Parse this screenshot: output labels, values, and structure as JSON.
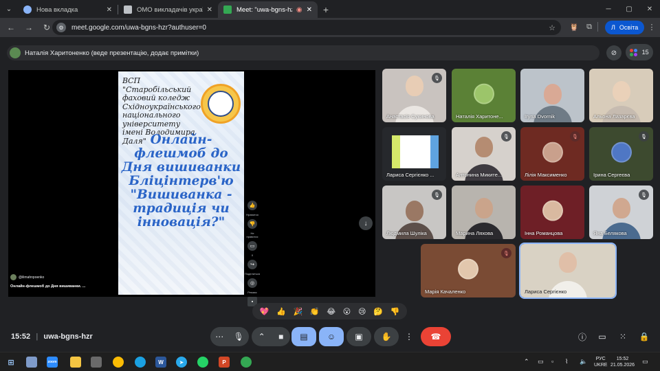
{
  "browser": {
    "tabs": [
      {
        "title": "Нова вкладка",
        "fav_color": "#8ab4f8"
      },
      {
        "title": "ОМО викладачів української л",
        "fav_color": "#bdc1c6"
      },
      {
        "title": "Meet: \"uwa-bgns-hzr\"",
        "fav_color": "#34a853"
      }
    ],
    "url": "meet.google.com/uwa-bgns-hzr?authuser=0",
    "profile_initial": "Л",
    "profile_name": "Освіта"
  },
  "meet": {
    "presenter_text": "Наталія Харитоненко (веде презентацію, додає примітки)",
    "participants_count": "15",
    "meeting_time": "15:52",
    "meeting_code": "uwa-bgns-hzr"
  },
  "presentation": {
    "institution": "ВСП \"Старобільський фаховий коледж Східноукраїнського національного університету імені Володимира Даля\"",
    "title": "Онлайн-флешмоб до Дня вишиванки Бліцінтерв'ю \"Вишиванка - традиція чи інновація?\"",
    "rail_labels": [
      "Нравится",
      "Не нравится",
      "0",
      "Поделиться",
      "Ремикс"
    ],
    "author_handle": "@ilimahnpoenko",
    "caption": "Онлайн-флешмоб до Дня вишиванки. ..."
  },
  "participants": [
    {
      "name": "Анастасія Сухинова",
      "muted": true
    },
    {
      "name": "Наталія Харитоне...",
      "muted": false
    },
    {
      "name": "Iryna Dvornik",
      "muted": false
    },
    {
      "name": "Альона Лазарєва",
      "muted": false
    },
    {
      "name": "Лариса Сергієнко ...",
      "muted": false
    },
    {
      "name": "Антонина Микитe...",
      "muted": true
    },
    {
      "name": "Лілія Максименко",
      "muted": true
    },
    {
      "name": "Ірина Сергеєва",
      "muted": true
    },
    {
      "name": "Людмила Шуліка",
      "muted": true
    },
    {
      "name": "Марина Ляхова",
      "muted": false
    },
    {
      "name": "Інна Романцова",
      "muted": false
    },
    {
      "name": "Яна Белякова",
      "muted": true
    },
    {
      "name": "Марія Качаленко",
      "muted": true
    },
    {
      "name": "Лариса Сергієнко",
      "muted": false
    }
  ],
  "reactions": [
    "💖",
    "👍",
    "🎉",
    "👏",
    "😂",
    "😮",
    "😢",
    "🤔",
    "👎"
  ],
  "taskbar": {
    "lang_line1": "РУС",
    "lang_line2": "UKRE",
    "time": "15:52",
    "date": "21.05.2026"
  },
  "colors": {
    "meet_bg": "#202124",
    "accent_blue": "#8ab4f8",
    "leave_red": "#ea4335",
    "poster_title": "#2a64c7"
  }
}
